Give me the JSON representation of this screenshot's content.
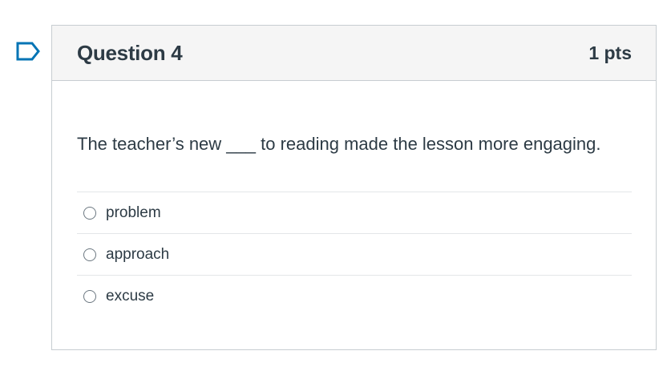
{
  "question": {
    "title": "Question 4",
    "points": "1 pts",
    "text": "The teacher’s new ___ to reading made the lesson more engaging.",
    "answers": [
      {
        "label": "problem",
        "selected": false
      },
      {
        "label": "approach",
        "selected": false
      },
      {
        "label": "excuse",
        "selected": false
      }
    ]
  },
  "colors": {
    "accent": "#0374b5",
    "text": "#2d3b45",
    "header_bg": "#f5f5f5",
    "border": "#c7cdd1"
  },
  "icons": {
    "flag": "bookmark-flag-icon",
    "radio": "radio-unchecked-icon"
  }
}
